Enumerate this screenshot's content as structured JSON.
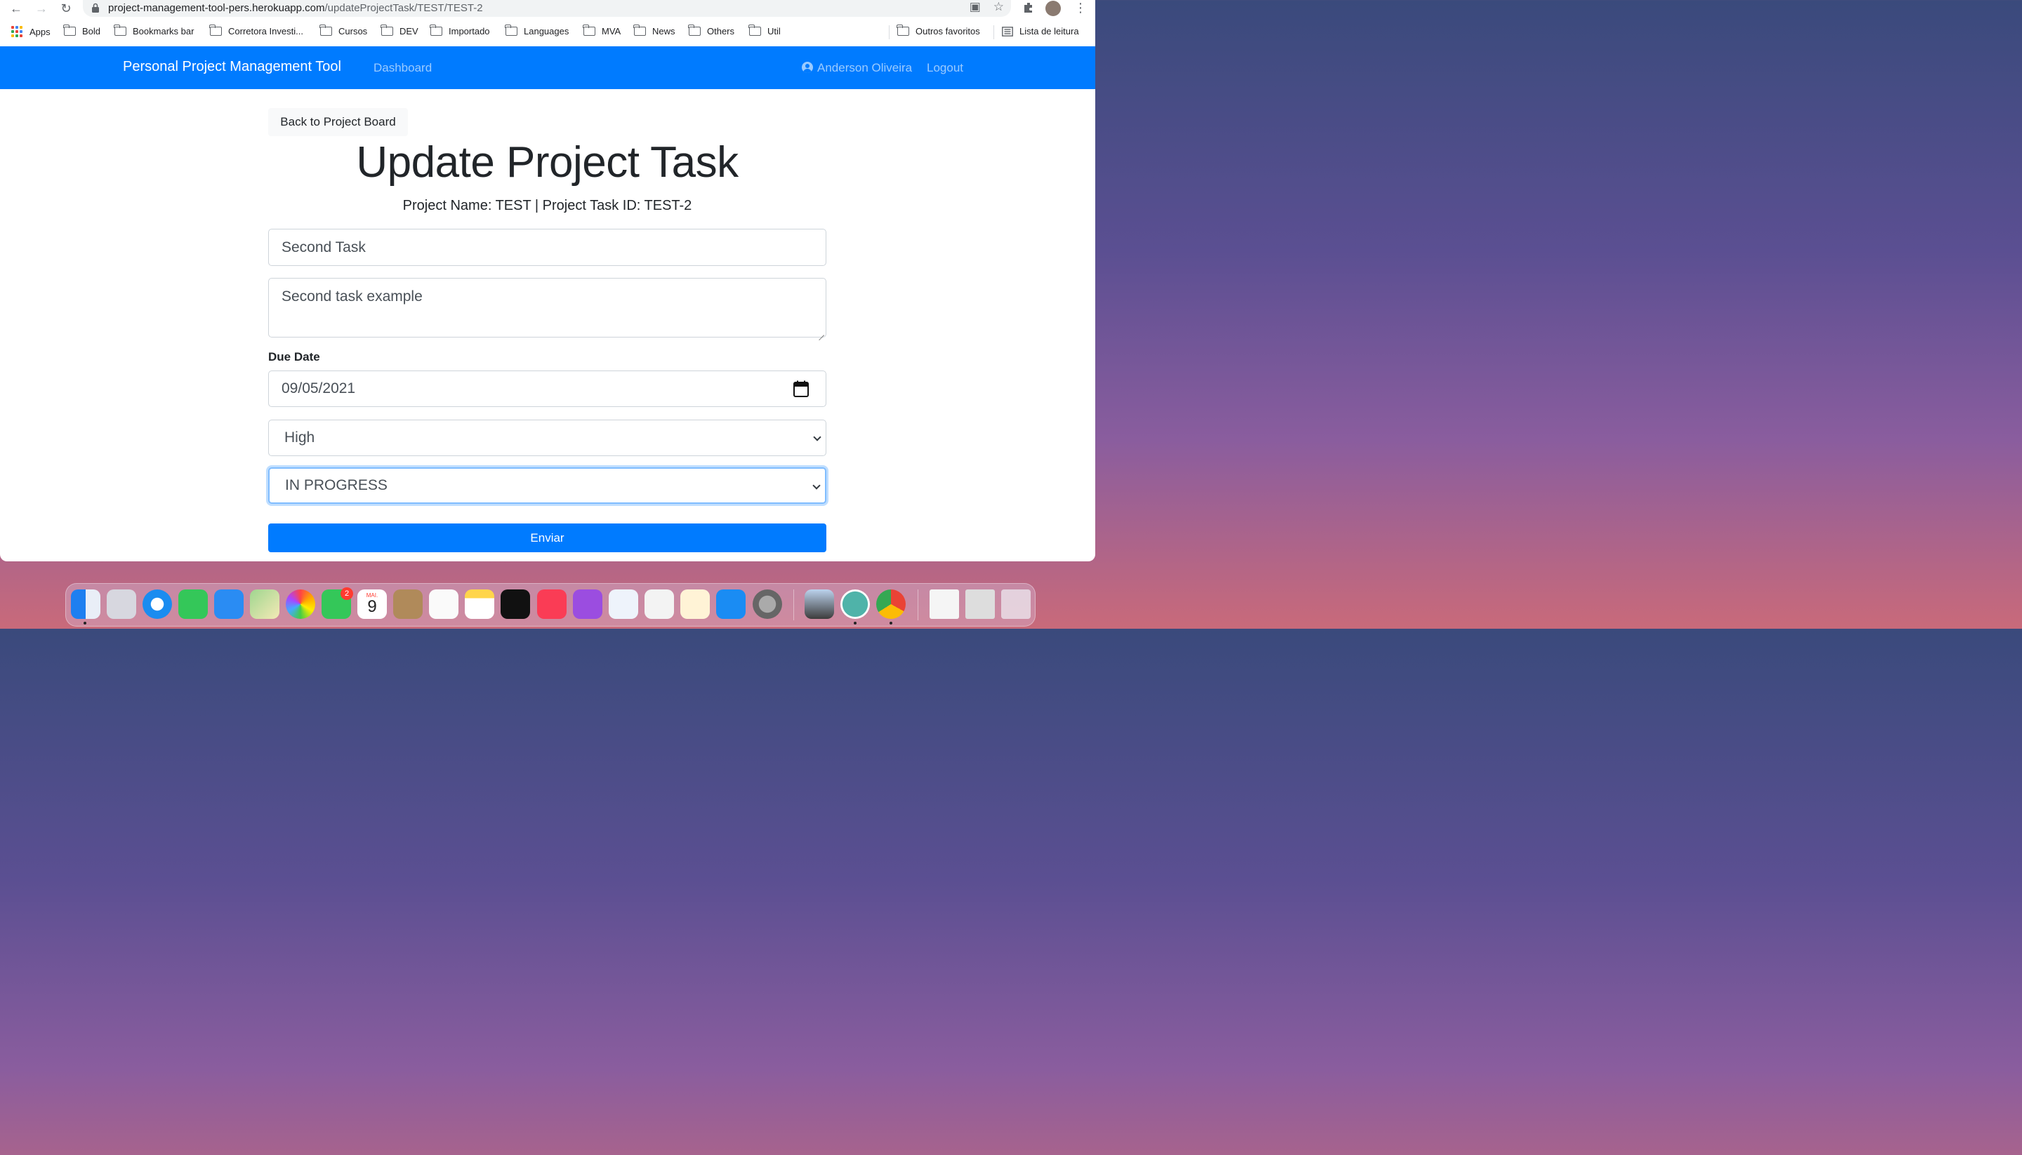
{
  "browser": {
    "url_host": "project-management-tool-pers.herokuapp.com",
    "url_path": "/updateProjectTask/TEST/TEST-2",
    "bookmarks": [
      {
        "label": "Apps",
        "type": "apps"
      },
      {
        "label": "Bold",
        "type": "folder"
      },
      {
        "label": "Bookmarks bar",
        "type": "folder"
      },
      {
        "label": "Corretora Investi...",
        "type": "folder"
      },
      {
        "label": "Cursos",
        "type": "folder"
      },
      {
        "label": "DEV",
        "type": "folder"
      },
      {
        "label": "Importado",
        "type": "folder"
      },
      {
        "label": "Languages",
        "type": "folder"
      },
      {
        "label": "MVA",
        "type": "folder"
      },
      {
        "label": "News",
        "type": "folder"
      },
      {
        "label": "Others",
        "type": "folder"
      },
      {
        "label": "Util",
        "type": "folder"
      }
    ],
    "other_bookmarks": "Outros favoritos",
    "reading_list": "Lista de leitura"
  },
  "navbar": {
    "brand": "Personal Project Management Tool",
    "dashboard": "Dashboard",
    "user": "Anderson Oliveira",
    "logout": "Logout",
    "bg_color": "#007bff"
  },
  "page": {
    "back_button": "Back to Project Board",
    "title": "Update Project Task",
    "subtitle": "Project Name: TEST | Project Task ID: TEST-2",
    "summary_value": "Second Task",
    "acceptance_value": "Second task example",
    "due_date_label": "Due Date",
    "due_date_value": "09/05/2021",
    "priority_value": "High",
    "status_value": "IN PROGRESS",
    "submit": "Enviar"
  },
  "dock": {
    "calendar_month": "MAI.",
    "calendar_day": "9",
    "facetime_badge": "2",
    "apps": [
      "finder-icon",
      "launchpad-icon",
      "safari-icon",
      "messages-icon",
      "mail-icon",
      "maps-icon",
      "photos-icon",
      "facetime-icon",
      "calendar-icon",
      "contacts-icon",
      "reminders-icon",
      "notes-icon",
      "tv-icon",
      "music-icon",
      "podcasts-icon",
      "keynote-icon",
      "numbers-icon",
      "pages-icon",
      "app-store-icon",
      "system-preferences-icon",
      "preview-icon",
      "vpn-icon",
      "chrome-icon",
      "documents-icon",
      "downloads-icon",
      "trash-icon"
    ]
  }
}
